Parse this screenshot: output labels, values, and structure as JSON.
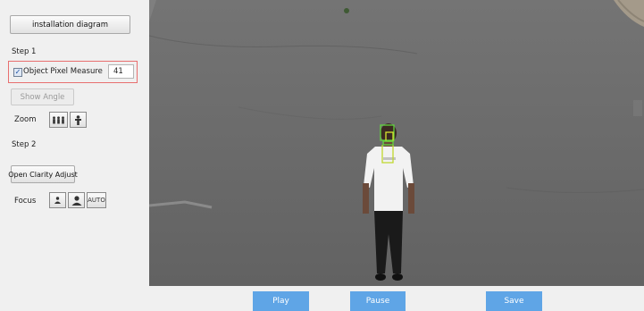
{
  "left_panel": {
    "diagram_button": "installation diagram",
    "step1_label": "Step 1",
    "object_pixel_measure": {
      "label": "Object Pixel Measure",
      "checked": true,
      "value": "41"
    },
    "show_angle_button": "Show Angle",
    "zoom_label": "Zoom",
    "zoom_icons": [
      "zoom-out-people-icon",
      "zoom-in-person-icon"
    ],
    "step2_label": "Step 2",
    "clarity_button": "Open Clarity Adjust",
    "focus_label": "Focus",
    "focus_buttons": {
      "near_icon": "small-person-icon",
      "far_icon": "large-person-icon",
      "auto_label": "AUTO"
    }
  },
  "video": {
    "description_icons": [
      "person-figure",
      "face-detection-box"
    ]
  },
  "controls": {
    "play_label": "Play",
    "pause_label": "Pause",
    "save_label": "Save",
    "accent_color": "#5fa5e6",
    "highlight_color": "#e86f6f"
  }
}
